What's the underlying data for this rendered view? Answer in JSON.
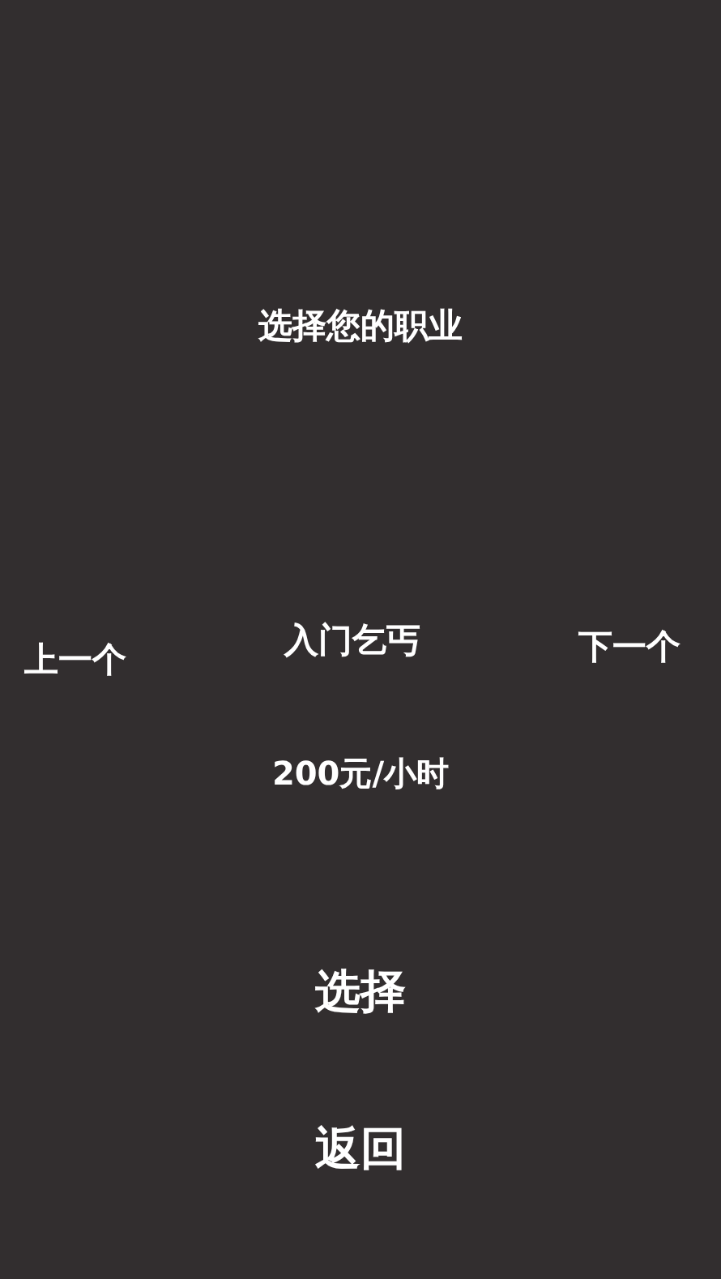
{
  "title": "选择您的职业",
  "navigation": {
    "previous": "上一个",
    "next": "下一个"
  },
  "career": {
    "name": "入门乞丐",
    "wage": "200元/小时"
  },
  "buttons": {
    "select": "选择",
    "back": "返回"
  }
}
